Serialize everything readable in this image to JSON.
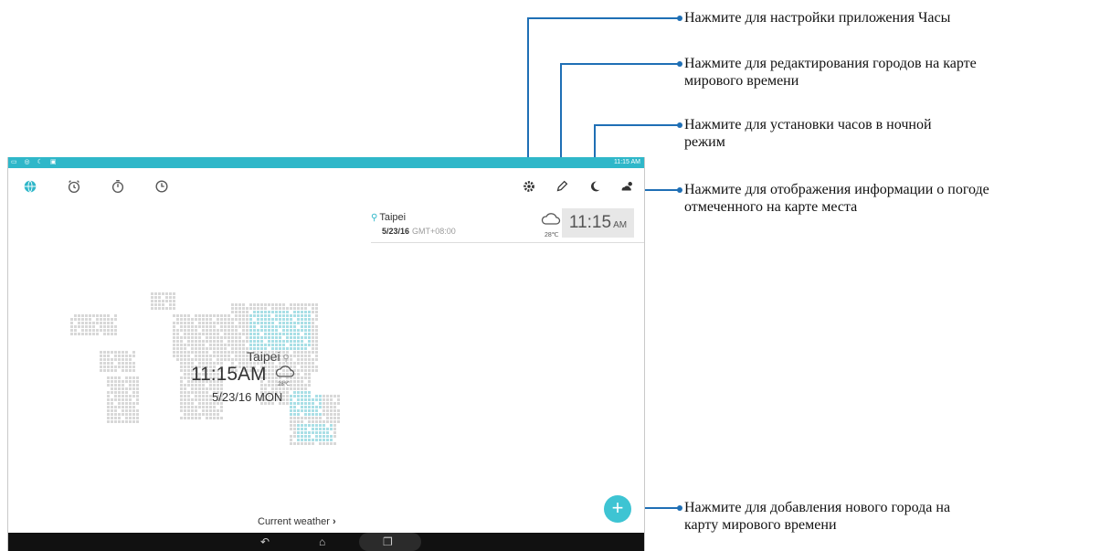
{
  "status_bar": {
    "time": "11:15 AM"
  },
  "toolbar": {
    "left_icons": [
      "world-clock-icon",
      "alarm-icon",
      "stopwatch-icon",
      "timer-icon"
    ],
    "right_icons": [
      "settings-icon",
      "edit-icon",
      "night-mode-icon",
      "weather-icon"
    ]
  },
  "city_card": {
    "city": "Taipei",
    "date": "5/23/16",
    "gmt": "GMT+08:00",
    "temp": "28℃",
    "time": "11:15",
    "ampm": "AM"
  },
  "map_marker": {
    "city": "Taipei",
    "time": "11:15AM",
    "temp": "28℃",
    "date": "5/23/16 MON"
  },
  "current_weather": {
    "label": "Current weather"
  },
  "fab": {
    "label": "+"
  },
  "callouts": {
    "settings": "Нажмите для настройки приложения Часы",
    "edit_line1": "Нажмите для редактирования городов на карте",
    "edit_line2": "мирового времени",
    "night_line1": "Нажмите для установки часов в ночной",
    "night_line2": "режим",
    "weather_line1": "Нажмите для отображения информации о погоде",
    "weather_line2": "отмеченного на карте места",
    "add_line1": "Нажмите для добавления нового города на",
    "add_line2": "карту мирового времени"
  },
  "colors": {
    "accent": "#2fb7c9",
    "leader": "#1f6fb5"
  }
}
